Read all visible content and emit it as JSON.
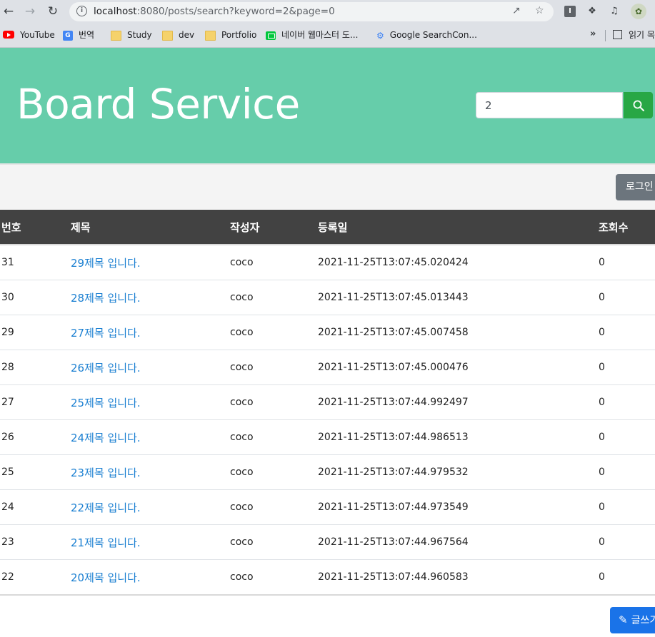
{
  "browser": {
    "url_host": "localhost",
    "url_path": ":8080/posts/search?keyword=2&page=0",
    "bookmarks": [
      {
        "label": "YouTube",
        "icon": "youtube-icon"
      },
      {
        "label": "번역",
        "icon": "google-translate-icon"
      },
      {
        "label": "Study",
        "icon": "folder-icon"
      },
      {
        "label": "dev",
        "icon": "folder-icon"
      },
      {
        "label": "Portfolio",
        "icon": "folder-icon"
      },
      {
        "label": "네이버 웹마스터 도...",
        "icon": "naver-webmaster-icon"
      },
      {
        "label": "Google SearchCon...",
        "icon": "google-search-console-icon"
      }
    ],
    "more_label": "»",
    "reading_list_label": "읽기 목",
    "extension_i_label": "I"
  },
  "header": {
    "title": "Board Service",
    "search_value": "2"
  },
  "toolbar": {
    "login_label": "로그인"
  },
  "table": {
    "headers": {
      "no": "번호",
      "title": "제목",
      "author": "작성자",
      "date": "등록일",
      "views": "조회수"
    },
    "rows": [
      {
        "no": "31",
        "title": "29제목 입니다.",
        "author": "coco",
        "date": "2021-11-25T13:07:45.020424",
        "views": "0"
      },
      {
        "no": "30",
        "title": "28제목 입니다.",
        "author": "coco",
        "date": "2021-11-25T13:07:45.013443",
        "views": "0"
      },
      {
        "no": "29",
        "title": "27제목 입니다.",
        "author": "coco",
        "date": "2021-11-25T13:07:45.007458",
        "views": "0"
      },
      {
        "no": "28",
        "title": "26제목 입니다.",
        "author": "coco",
        "date": "2021-11-25T13:07:45.000476",
        "views": "0"
      },
      {
        "no": "27",
        "title": "25제목 입니다.",
        "author": "coco",
        "date": "2021-11-25T13:07:44.992497",
        "views": "0"
      },
      {
        "no": "26",
        "title": "24제목 입니다.",
        "author": "coco",
        "date": "2021-11-25T13:07:44.986513",
        "views": "0"
      },
      {
        "no": "25",
        "title": "23제목 입니다.",
        "author": "coco",
        "date": "2021-11-25T13:07:44.979532",
        "views": "0"
      },
      {
        "no": "24",
        "title": "22제목 입니다.",
        "author": "coco",
        "date": "2021-11-25T13:07:44.973549",
        "views": "0"
      },
      {
        "no": "23",
        "title": "21제목 입니다.",
        "author": "coco",
        "date": "2021-11-25T13:07:44.967564",
        "views": "0"
      },
      {
        "no": "22",
        "title": "20제목 입니다.",
        "author": "coco",
        "date": "2021-11-25T13:07:44.960583",
        "views": "0"
      }
    ]
  },
  "footer": {
    "write_label": "글쓰기"
  },
  "colors": {
    "hero": "#66cdaa",
    "table_header": "#424242",
    "search_button": "#28a745",
    "login_button": "#6c757d",
    "write_button": "#1a73e8",
    "link": "#1a7fd1"
  }
}
